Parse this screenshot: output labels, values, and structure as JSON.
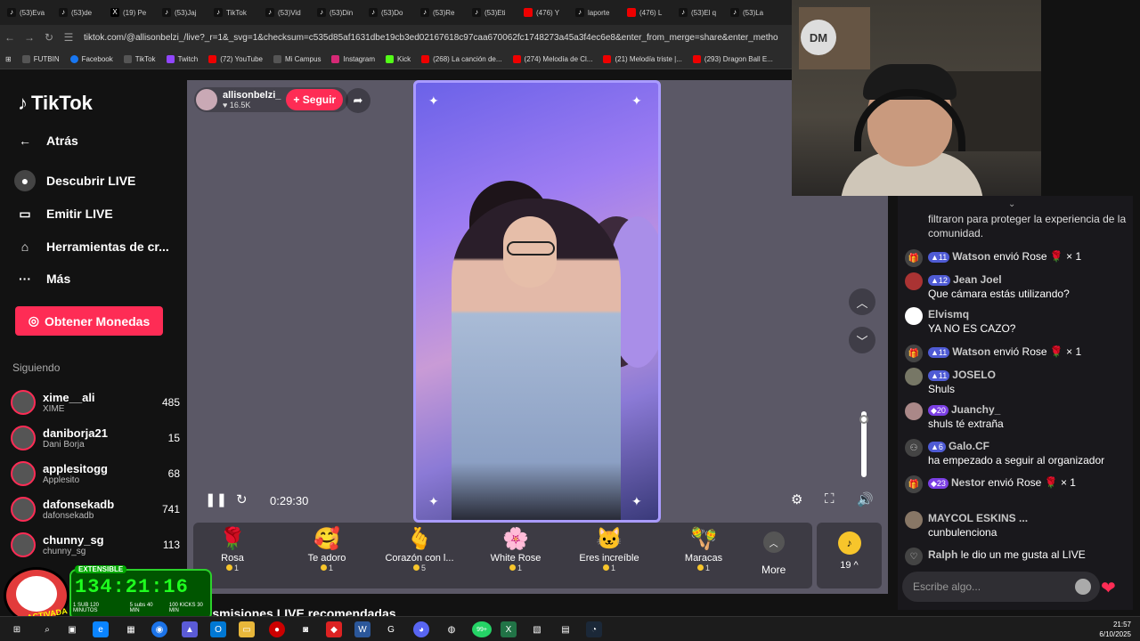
{
  "browser": {
    "tabs": [
      "(53)Eva",
      "(53)de",
      "(19) Pe",
      "(53)Jaj",
      "TikTok",
      "(53)Vid",
      "(53)Din",
      "(53)Do",
      "(53)Re",
      "(53)Eti",
      "(476) Y",
      "laporte",
      "(476) L",
      "(53)El q",
      "(53)La"
    ],
    "url": "tiktok.com/@allisonbelzi_/live?_r=1&_svg=1&checksum=c535d85af1631dbe19cb3ed02167618c97caa670062fc1748273a45a3f4ec6e8&enter_from_merge=share&enter_method=share&sec_u",
    "bookmarks": [
      "FUTBIN",
      "Facebook",
      "TikTok",
      "Twitch",
      "(72) YouTube",
      "Mi Campus",
      "Instagram",
      "Kick",
      "(268) La canción de...",
      "(274) Melodía de Cl...",
      "(21) Melodía triste |...",
      "(293) Dragon Ball E..."
    ]
  },
  "sidebar": {
    "logo": "TikTok",
    "back": "Atrás",
    "nav": [
      "Descubrir LIVE",
      "Emitir LIVE",
      "Herramientas de cr...",
      "Más"
    ],
    "coins_button": "Obtener Monedas",
    "following_header": "Siguiendo",
    "following": [
      {
        "name": "xime__ali",
        "sub": "XIME",
        "count": "485"
      },
      {
        "name": "daniborja21",
        "sub": "Dani Borja",
        "count": "15"
      },
      {
        "name": "applesitogg",
        "sub": "Applesito",
        "count": "68"
      },
      {
        "name": "dafonsekadb",
        "sub": "dafonsekadb",
        "count": "741"
      },
      {
        "name": "chunny_sg",
        "sub": "chunny_sg",
        "count": "113"
      }
    ]
  },
  "stream": {
    "host_name": "allisonbelzi_",
    "host_likes": "16.5K",
    "follow_label": "+ Seguir",
    "timer": "0:29:30",
    "gifts": [
      {
        "name": "Rosa",
        "price": "1",
        "icon": "🌹"
      },
      {
        "name": "Te adoro",
        "price": "1",
        "icon": "🥰"
      },
      {
        "name": "Corazón con l...",
        "price": "5",
        "icon": "🫰"
      },
      {
        "name": "White Rose",
        "price": "1",
        "icon": "🌸"
      },
      {
        "name": "Eres increíble",
        "price": "1",
        "icon": "🐱"
      },
      {
        "name": "Maracas",
        "price": "1",
        "icon": "🪇"
      }
    ],
    "more_label": "More",
    "coin_value": "19 ^",
    "recommended_heading": "ansmisiones LIVE recomendadas"
  },
  "chat": {
    "messages": [
      {
        "user": "",
        "level": "",
        "text": "filtraron para proteger la experiencia de la comunidad."
      },
      {
        "user": "Watson",
        "level": "11",
        "text": "envió Rose 🌹 × 1"
      },
      {
        "user": "Jean Joel",
        "level": "12",
        "text": "Que cámara estás utilizando?"
      },
      {
        "user": "Elvismq",
        "level": "",
        "text": "YA NO ES CAZO?"
      },
      {
        "user": "Watson",
        "level": "11",
        "text": "envió Rose 🌹 × 1"
      },
      {
        "user": "JOSELO",
        "level": "11",
        "text": "Shuls"
      },
      {
        "user": "Juanchy_",
        "level": "20",
        "text": "shuls té extraña"
      },
      {
        "user": "Galo.CF",
        "level": "6",
        "text": "ha empezado a seguir al organizador"
      },
      {
        "user": "Nestor",
        "level": "23",
        "text": "envió Rose 🌹 × 1"
      },
      {
        "user": "MAYCOL ESKINS ...",
        "level": "",
        "text": "cunbulenciona"
      },
      {
        "user": "Ralph",
        "level": "",
        "text": "le dio un me gusta al LIVE"
      }
    ],
    "input_placeholder": "Escribe algo..."
  },
  "overlay": {
    "badge": "EXTENSIBLE",
    "countdown": "134:21:16",
    "mini": [
      "1 SUB 120 MINUTOS",
      "5 subs 40 MIN",
      "100 KICKS 30 MIN"
    ],
    "activated": "ACTIVADA"
  },
  "taskbar": {
    "time": "21:57",
    "date": "6/10/2025",
    "badge": "99+"
  }
}
